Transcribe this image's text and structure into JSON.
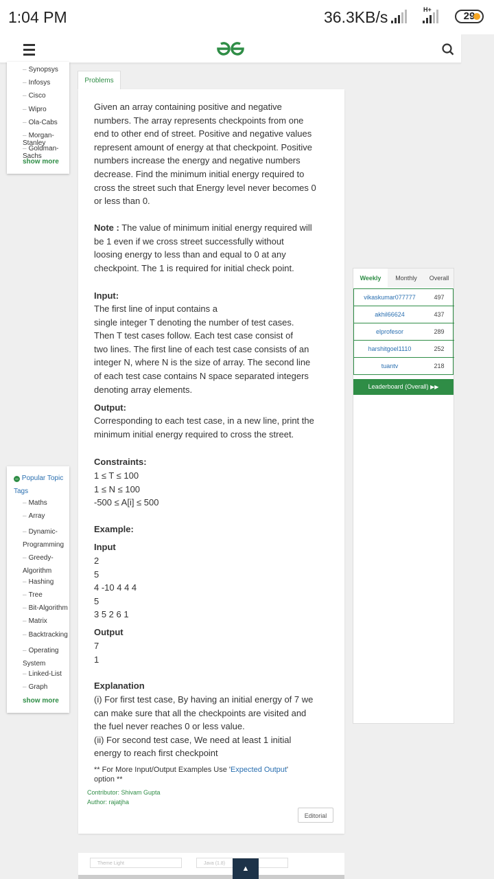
{
  "status_bar": {
    "time": "1:04 PM",
    "speed": "36.3KB/s",
    "network_type": "H+",
    "battery": "29"
  },
  "nav": {
    "menu_icon": "hamburger-menu-icon",
    "logo_icon": "gfg-logo-icon",
    "search_icon": "search-icon"
  },
  "company_tags": {
    "items": [
      "Synopsys",
      "Infosys",
      "Cisco",
      "Wipro",
      "Ola-Cabs",
      "Morgan-Stanley",
      "Goldman-Sachs"
    ],
    "show_more": "show more"
  },
  "topic_tags": {
    "title": "Popular Topic Tags",
    "items": [
      "Maths",
      "Array",
      "Dynamic-Programming",
      "Greedy-Algorithm",
      "Hashing",
      "Tree",
      "Bit-Algorithm",
      "Matrix",
      "Backtracking",
      "Operating System",
      "Linked-List",
      "Graph"
    ],
    "show_more": "show more"
  },
  "problem": {
    "tab_label": "Problems",
    "description_lines": [
      "Given an array containing positive and negative",
      "numbers. The array represents checkpoints from one",
      "end to other end of street. Positive and negative values",
      "represent amount of energy at that checkpoint. Positive",
      "numbers increase the energy and negative numbers",
      "decrease. Find the minimum initial energy required to",
      "cross the street such that Energy level never becomes 0",
      "or less than 0."
    ],
    "note_label": "Note :",
    "note_lines": [
      " The value of minimum initial energy required will",
      "be 1 even if we cross street successfully without",
      "loosing energy to less than and equal to 0 at any",
      "checkpoint. The 1 is required for initial check point."
    ],
    "input_heading": "Input:",
    "input_lines": [
      "The first line of input contains a",
      "single integer T denoting the number of test cases.",
      "Then T test cases follow. Each test case consist of",
      "two lines. The first line of each test case consists of an",
      "integer N, where N is the size of array. The second line",
      "of each test case contains N space separated integers",
      "denoting array elements."
    ],
    "output_heading": "Output:",
    "output_lines": [
      "Corresponding to each test case, in a new line, print the",
      "minimum initial energy required to cross the street."
    ],
    "constraints_heading": "Constraints:",
    "constraints": [
      "1 ≤ T ≤ 100",
      "1 ≤ N ≤ 100",
      "-500 ≤ A[i] ≤ 500"
    ],
    "example_heading": "Example:",
    "example_input_heading": "Input",
    "example_input_lines": [
      "2",
      "5",
      "4 -10 4 4 4",
      "5",
      "3  5 2  6 1"
    ],
    "example_output_heading": "Output",
    "example_output_lines": [
      "7",
      "1"
    ],
    "explanation_heading": "Explanation",
    "explanation_lines": [
      "(i) For first test case, By having an initial energy of 7 we",
      "can make sure that all the checkpoints are visited and",
      "the fuel never reaches 0 or less value.",
      "(ii) For second test case, We need at least 1 initial",
      "energy to reach first checkpoint"
    ],
    "more_examples_prefix": "** For More Input/Output Examples Use '",
    "more_examples_link": "Expected Output",
    "more_examples_suffix": "'",
    "more_examples_line2": "option **",
    "contributor": "Contributor: Shivam Gupta",
    "author": "Author: rajatjha",
    "editorial_button": "Editorial"
  },
  "leaderboard": {
    "tabs": [
      "Weekly",
      "Monthly",
      "Overall"
    ],
    "active_tab": "Weekly",
    "rows": [
      {
        "name": "vikaskumar077777",
        "score": "497"
      },
      {
        "name": "akhil66624",
        "score": "437"
      },
      {
        "name": "elprofesor",
        "score": "289"
      },
      {
        "name": "harshitgoel1110",
        "score": "252"
      },
      {
        "name": "tuantv",
        "score": "218"
      }
    ],
    "button_label": "Leaderboard (Overall)"
  },
  "bottom_bar": {
    "theme_select": "Theme Light",
    "language_select": "Java (1.8)",
    "scroll_top_label": "▲"
  },
  "colors": {
    "brand_green": "#2f8d46",
    "link_blue": "#2a6fb0",
    "scroll_button": "#1d3349",
    "battery_dot": "#f5a623"
  }
}
